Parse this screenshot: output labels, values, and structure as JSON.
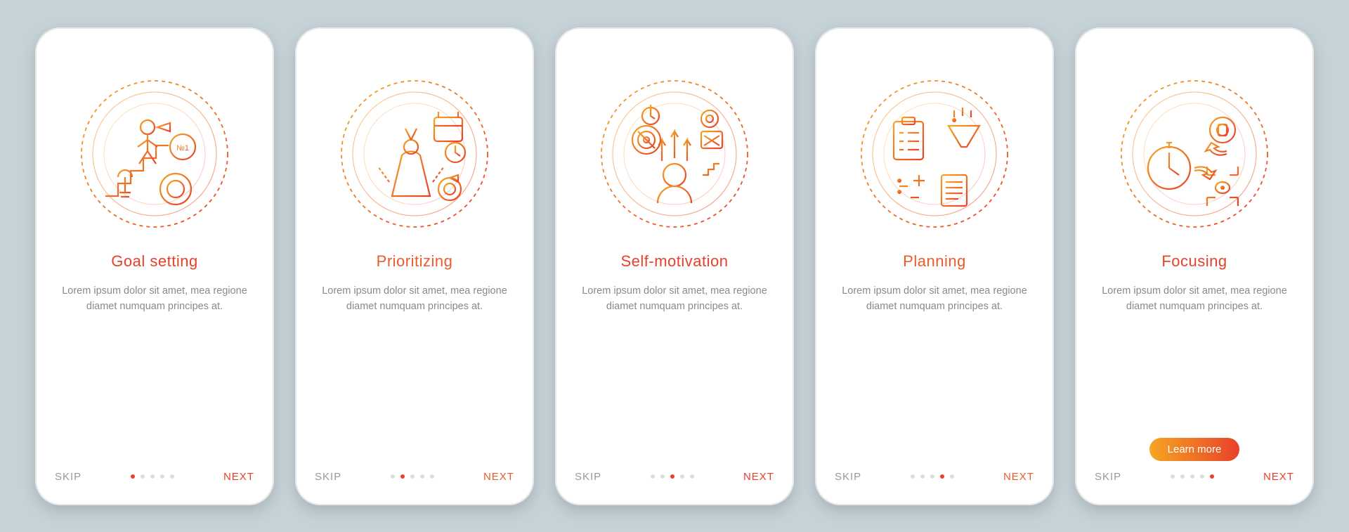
{
  "accent_start": "#f5a623",
  "accent_end": "#e8402a",
  "skip_label": "SKIP",
  "next_label": "NEXT",
  "cta_label": "Learn more",
  "description": "Lorem ipsum dolor sit amet, mea regione diamet numquam principes at.",
  "screens": [
    {
      "title": "Goal setting",
      "icon": "goal-setting",
      "active_dot": 0,
      "has_cta": false,
      "title_color": "#e8402a"
    },
    {
      "title": "Prioritizing",
      "icon": "prioritizing",
      "active_dot": 1,
      "has_cta": false,
      "title_color": "#ed5a2c"
    },
    {
      "title": "Self-motivation",
      "icon": "self-motivation",
      "active_dot": 2,
      "has_cta": false,
      "title_color": "#e8402a"
    },
    {
      "title": "Planning",
      "icon": "planning",
      "active_dot": 3,
      "has_cta": false,
      "title_color": "#ed5a2c"
    },
    {
      "title": "Focusing",
      "icon": "focusing",
      "active_dot": 4,
      "has_cta": true,
      "title_color": "#e8402a"
    }
  ]
}
